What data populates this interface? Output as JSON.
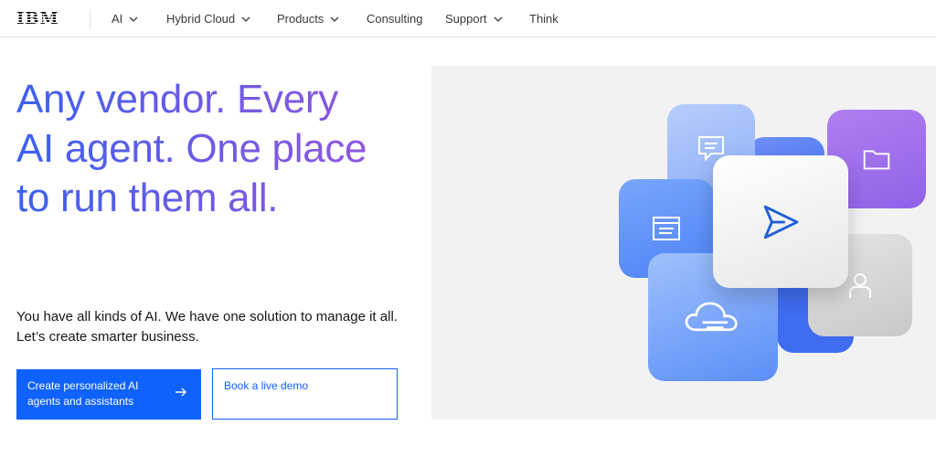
{
  "nav": {
    "logo": "IBM",
    "items": [
      {
        "label": "AI",
        "has_dropdown": true
      },
      {
        "label": "Hybrid Cloud",
        "has_dropdown": true
      },
      {
        "label": "Products",
        "has_dropdown": true
      },
      {
        "label": "Consulting",
        "has_dropdown": false
      },
      {
        "label": "Support",
        "has_dropdown": true
      },
      {
        "label": "Think",
        "has_dropdown": false
      }
    ]
  },
  "hero": {
    "headline_lines": [
      "Any vendor. Every",
      "AI agent. One place",
      "to run them all."
    ],
    "subcopy": "You have all kinds of AI. We have one solution to manage it all. Let’s create smarter business.",
    "primary_cta": "Create personalized AI agents and assistants",
    "secondary_cta": "Book a live demo"
  },
  "colors": {
    "accent": "#0f62fe",
    "headline_gradient_start": "#3b60f0",
    "headline_gradient_end": "#9a55db",
    "illustration_bg": "#f2f2f2"
  },
  "illustration": {
    "icons": [
      "chat-icon",
      "folder-icon",
      "window-icon",
      "send-icon",
      "user-icon",
      "cloud-icon"
    ]
  }
}
